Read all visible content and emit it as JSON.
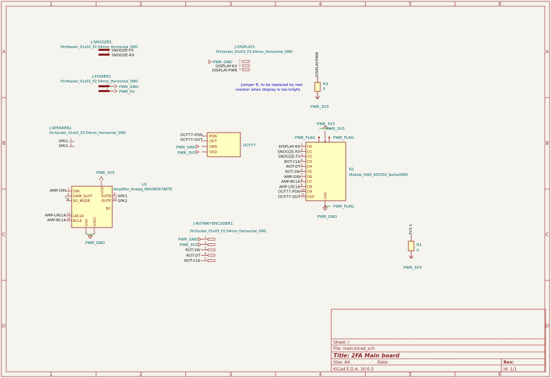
{
  "frame": {
    "col_labels": [
      "1",
      "2",
      "3",
      "4",
      "5",
      "6"
    ],
    "row_labels": [
      "A",
      "B",
      "C",
      "D"
    ]
  },
  "colors": {
    "page": "#f5f4ef",
    "border": "#b04848",
    "body_fill": "#ffffc2",
    "body_stroke": "#8c2020",
    "ref_text": "#006464",
    "label_text": "#202020",
    "pin_num": "#8c2020",
    "wire": "#008400",
    "note_text": "#0000c4",
    "title_text": "#8c2020"
  },
  "symbols": {
    "snooze": {
      "ref": "J-SNOOZE1",
      "value": "PinHeader_01x02_P2.54mm_Horizontal_SMD",
      "pins": [
        {
          "num": "1",
          "net": "SNOOZE-TX"
        },
        {
          "num": "2",
          "net": "SNOOZE-RX"
        }
      ]
    },
    "power": {
      "ref": "J-POWER1",
      "value": "PinHeader_01x02_P2.54mm_Horizontal_SMD",
      "pins": [
        {
          "num": "1",
          "net": "PWR_GND"
        },
        {
          "num": "2",
          "net": "PWR_5V"
        }
      ]
    },
    "display": {
      "ref": "J-DISPLAY1",
      "value": "PinSocket_01x03_P2.54mm_Horizontal_SMD",
      "pins": [
        {
          "num": "1",
          "net": "PWR_GND"
        },
        {
          "num": "2",
          "net": "DISPLAY-RX"
        },
        {
          "num": "3",
          "net": "DISPLAY-PWR"
        }
      ]
    },
    "r3": {
      "ref": "R3",
      "value": "0",
      "top_net": "DISPLAY-PWR",
      "bottom_net": "PWR_3V3"
    },
    "note": {
      "line1": "Jumper R, to be replaced by real",
      "line2": "resistor when display is too bright."
    },
    "speaker": {
      "ref": "J-SPEAKER1",
      "value": "PinSocket_01x02_P2.54mm_Horizontal_SMD",
      "pins": [
        {
          "num": "1",
          "net": "SPK1"
        },
        {
          "num": "2",
          "net": "SPK2"
        }
      ]
    },
    "dcf77": {
      "name": "DCF77",
      "pins": [
        {
          "label": "PON",
          "net": "DCF77-PON"
        },
        {
          "label": "OUT",
          "net": "DCF77-OUT"
        },
        {
          "label": "GND",
          "net": "PWR_GND"
        },
        {
          "label": "VDD",
          "net": "PWR_3V3"
        }
      ]
    },
    "u1": {
      "ref": "U1",
      "value": "Amplifier_Analog_MAX98357AETE",
      "power_net": "PWR_3V3",
      "gnd_net": "PWR_GND",
      "vdd_label": "VDD",
      "gnd_labels": [
        "GND",
        "GND2"
      ],
      "left_pins": [
        {
          "label": "DIN",
          "net": "AMP-DIN",
          "num": "1"
        },
        {
          "label": "GAIN_SLOT",
          "net": "",
          "num": "2"
        },
        {
          "label": "SD_MODE",
          "net": "",
          "num": "4"
        },
        {
          "label": "LRCLK",
          "net": "AMP-LRCLK",
          "num": "14"
        },
        {
          "label": "BCLK",
          "net": "AMP-BCLK",
          "num": "16"
        }
      ],
      "right_pins": [
        {
          "label": "OUTN",
          "net": "SPK1",
          "num": "9"
        },
        {
          "label": "OUTP",
          "net": "SPK2",
          "num": "10"
        },
        {
          "label": "NC",
          "net": "",
          "num": ""
        }
      ]
    },
    "r1": {
      "ref": "R1",
      "value": "Module_XIAO_RP2350_SocketSMD",
      "power_net": "PWR_3V3",
      "power_flag": "PWR_FLAG",
      "gnd_net": "PWR_GND",
      "top_pin_labels": [
        "5V",
        "3V3"
      ],
      "bottom_pin_label": "GND",
      "pins": [
        {
          "label": "D0",
          "net": "DISPLAY-RX",
          "num": "1"
        },
        {
          "label": "D1",
          "net": "SNOOZE-RX",
          "num": "2"
        },
        {
          "label": "D2",
          "net": "SNOOZE-TX",
          "num": "3"
        },
        {
          "label": "D3",
          "net": "ROT-CLK",
          "num": "4"
        },
        {
          "label": "D4",
          "net": "ROT-DT",
          "num": "5"
        },
        {
          "label": "D5",
          "net": "ROT-SW",
          "num": "6"
        },
        {
          "label": "D6",
          "net": "AMP-DIN",
          "num": "7"
        },
        {
          "label": "D7",
          "net": "AMP-BCLK",
          "num": "8"
        },
        {
          "label": "D8",
          "net": "AMP-LRCLK",
          "num": "9"
        },
        {
          "label": "D9",
          "net": "DCF77-PON",
          "num": "10"
        },
        {
          "label": "D10",
          "net": "DCF77-OUT",
          "num": "11"
        }
      ]
    },
    "rotary": {
      "ref": "J-ROTARY-ENCODER1",
      "value": "PinSocket_01x05_P2.54mm_Horizontal_SMD",
      "pins": [
        {
          "num": "1",
          "net": "PWR_GND"
        },
        {
          "num": "2",
          "net": "PWR_3V3"
        },
        {
          "num": "3",
          "net": "ROT-SW"
        },
        {
          "num": "4",
          "net": "ROT-DT"
        },
        {
          "num": "5",
          "net": "ROT-CLK"
        }
      ]
    },
    "r_3v3": {
      "ref": "R1",
      "value": "0",
      "top_net": "3V3-1",
      "bottom_net": "PWR_3V3"
    }
  },
  "title_block": {
    "sheet": "Sheet: /",
    "file": "File: main.kicad_sch",
    "title": "Title: 2FA Main board",
    "size": "Size: A4",
    "date": "Date:",
    "rev": "Rev:",
    "tool": "KiCad E.D.A. 10.0.3",
    "id": "Id: 1/1"
  }
}
